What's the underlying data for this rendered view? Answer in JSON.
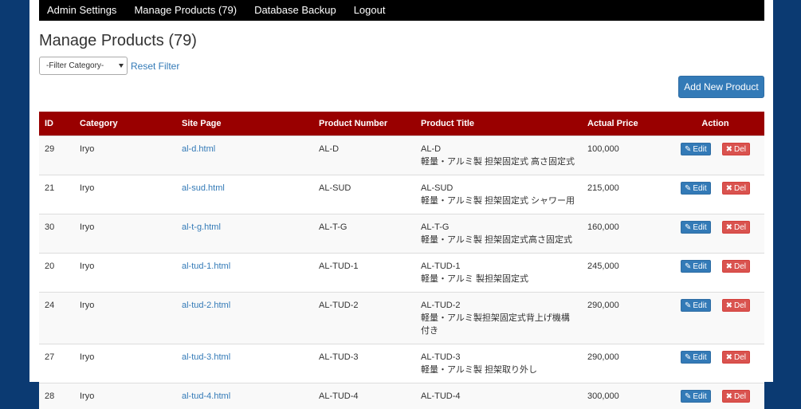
{
  "nav": {
    "items": [
      "Admin Settings",
      "Manage Products (79)",
      "Database Backup",
      "Logout"
    ]
  },
  "page": {
    "title": "Manage Products (79)",
    "filter_selected": "-Filter Category-",
    "reset_label": "Reset Filter",
    "add_label": "Add New Product"
  },
  "table": {
    "headers": [
      "ID",
      "Category",
      "Site Page",
      "Product Number",
      "Product Title",
      "Actual Price",
      "Action"
    ],
    "edit_label": "Edit",
    "del_label": "Del",
    "rows": [
      {
        "id": "29",
        "category": "Iryo",
        "site": "al-d.html",
        "number": "AL-D",
        "title1": "AL-D",
        "title2": "軽量・アルミ製 担架固定式 高さ固定式",
        "price": "100,000"
      },
      {
        "id": "21",
        "category": "Iryo",
        "site": "al-sud.html",
        "number": "AL-SUD",
        "title1": "AL-SUD",
        "title2": "軽量・アルミ製 担架固定式 シャワー用",
        "price": "215,000"
      },
      {
        "id": "30",
        "category": "Iryo",
        "site": "al-t-g.html",
        "number": "AL-T-G",
        "title1": "AL-T-G",
        "title2": "軽量・アルミ製 担架固定式高さ固定式",
        "price": "160,000"
      },
      {
        "id": "20",
        "category": "Iryo",
        "site": "al-tud-1.html",
        "number": "AL-TUD-1",
        "title1": "AL-TUD-1",
        "title2": "軽量・アルミ 製担架固定式",
        "price": "245,000"
      },
      {
        "id": "24",
        "category": "Iryo",
        "site": "al-tud-2.html",
        "number": "AL-TUD-2",
        "title1": "AL-TUD-2",
        "title2": "軽量・アルミ製担架固定式背上げ機構付き",
        "price": "290,000"
      },
      {
        "id": "27",
        "category": "Iryo",
        "site": "al-tud-3.html",
        "number": "AL-TUD-3",
        "title1": "AL-TUD-3",
        "title2": "軽量・アルミ製 担架取り外し",
        "price": "290,000"
      },
      {
        "id": "28",
        "category": "Iryo",
        "site": "al-tud-4.html",
        "number": "AL-TUD-4",
        "title1": "AL-TUD-4",
        "title2": "",
        "price": "300,000"
      }
    ]
  }
}
